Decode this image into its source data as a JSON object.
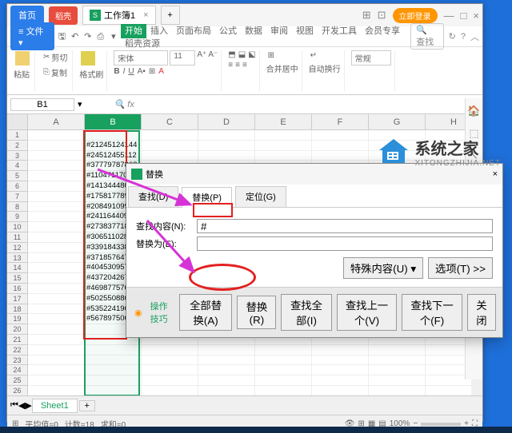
{
  "titlebar": {
    "home": "首页",
    "redtab": "稻壳",
    "doc": "工作簿1",
    "add": "+",
    "login": "立即登录"
  },
  "menu": {
    "file": "文件",
    "tabs": [
      "开始",
      "插入",
      "页面布局",
      "公式",
      "数据",
      "审阅",
      "视图",
      "开发工具",
      "会员专享",
      "稻壳资源"
    ],
    "search": "查找"
  },
  "toolbar": {
    "paste": "粘贴",
    "cut": "剪切",
    "copy": "复制",
    "fmt": "格式刷",
    "font": "宋体",
    "size": "11",
    "merge": "合并居中",
    "wrap": "自动换行",
    "general": "常规"
  },
  "namebox": {
    "cell": "B1",
    "fx": "fx"
  },
  "cols": [
    "A",
    "B",
    "C",
    "D",
    "E",
    "F",
    "G",
    "H"
  ],
  "rows_count": 26,
  "data_b": [
    "",
    "#21245124144",
    "#24512455112",
    "#37779787808",
    "#11047117044",
    "#14134448018",
    "#17581778984",
    "#2084910995",
    "#24116440925",
    "#27383771882",
    "#30651102848",
    "#33918433815",
    "#37185764781",
    "#40453095748",
    "#43720426714",
    "#46987757694",
    "#50255088664",
    "#53522419632",
    "#56789750600",
    "",
    "",
    "",
    "",
    "",
    "",
    ""
  ],
  "dialog": {
    "title": "替换",
    "tabs": {
      "find": "查找(D)",
      "replace": "替换(P)",
      "goto": "定位(G)"
    },
    "find_label": "查找内容(N):",
    "replace_label": "替换为(E):",
    "find_value": "#",
    "replace_value": "",
    "special": "特殊内容(U) ▾",
    "options": "选项(T) >>",
    "tips": "操作技巧",
    "replace_all": "全部替换(A)",
    "replace_btn": "替换(R)",
    "find_all": "查找全部(I)",
    "find_prev": "查找上一个(V)",
    "find_next": "查找下一个(F)",
    "close": "关闭"
  },
  "sheettabs": {
    "sheet1": "Sheet1",
    "add": "+"
  },
  "status": {
    "avg": "平均值=0",
    "count": "计数=18",
    "sum": "求和=0",
    "zoom": "100%"
  },
  "watermark": {
    "cn": "系统之家",
    "en": "XITONGZHIJIA.NET"
  }
}
